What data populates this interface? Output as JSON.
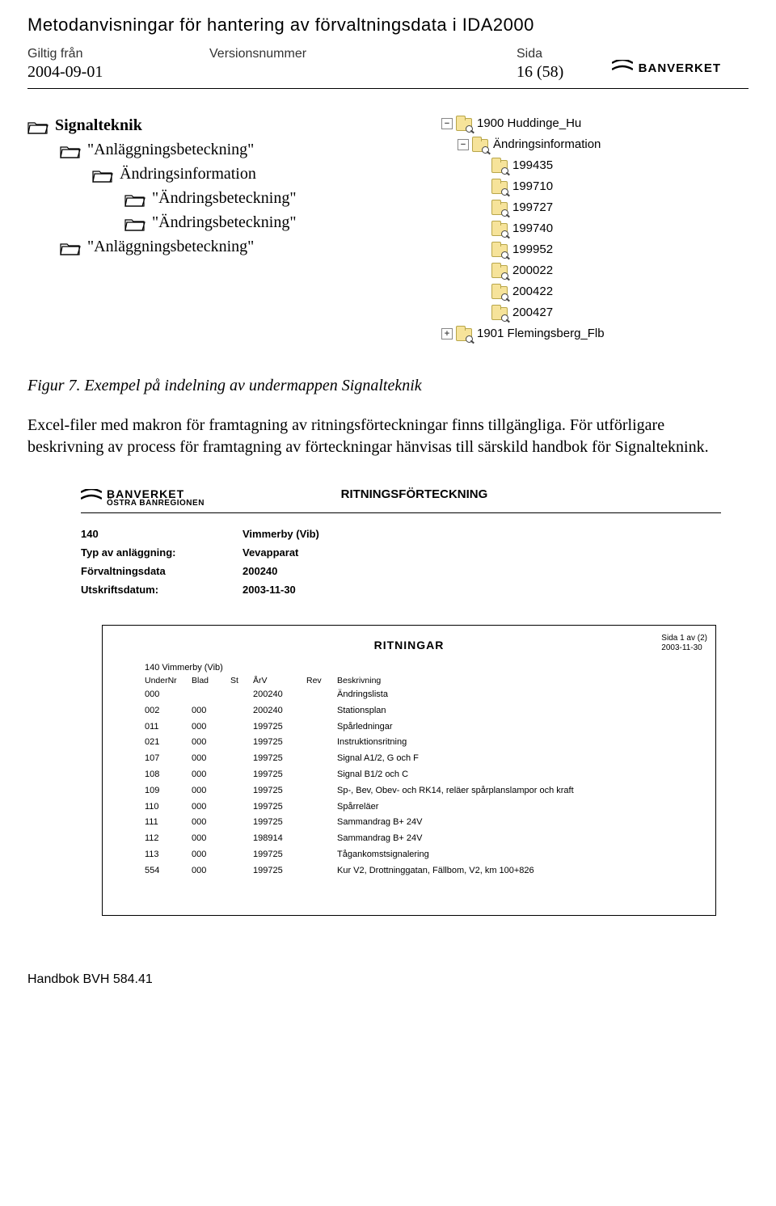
{
  "doc": {
    "title": "Metodanvisningar för hantering av förvaltningsdata i IDA2000",
    "meta_labels": {
      "from": "Giltig från",
      "ver": "Versionsnummer",
      "page": "Sida"
    },
    "meta_values": {
      "from": "2004-09-01",
      "ver": "",
      "page": "16 (58)"
    },
    "logo_text": "BANVERKET",
    "footer": "Handbok BVH 584.41"
  },
  "outline": [
    {
      "indent": 0,
      "bold": true,
      "label": "Signalteknik"
    },
    {
      "indent": 1,
      "bold": false,
      "label": "\"Anläggningsbeteckning\""
    },
    {
      "indent": 2,
      "bold": false,
      "label": "Ändringsinformation"
    },
    {
      "indent": 3,
      "bold": false,
      "label": "\"Ändringsbeteckning\""
    },
    {
      "indent": 3,
      "bold": false,
      "label": "\"Ändringsbeteckning\""
    },
    {
      "indent": 1,
      "bold": false,
      "label": "\"Anläggningsbeteckning\""
    }
  ],
  "tree": {
    "items": [
      {
        "indent": 1,
        "exp": "-",
        "label": "1900 Huddinge_Hu"
      },
      {
        "indent": 2,
        "exp": "-",
        "label": "Ändringsinformation"
      },
      {
        "indent": 3,
        "exp": "",
        "label": "199435"
      },
      {
        "indent": 3,
        "exp": "",
        "label": "199710"
      },
      {
        "indent": 3,
        "exp": "",
        "label": "199727"
      },
      {
        "indent": 3,
        "exp": "",
        "label": "199740"
      },
      {
        "indent": 3,
        "exp": "",
        "label": "199952"
      },
      {
        "indent": 3,
        "exp": "",
        "label": "200022"
      },
      {
        "indent": 3,
        "exp": "",
        "label": "200422"
      },
      {
        "indent": 3,
        "exp": "",
        "label": "200427"
      },
      {
        "indent": 1,
        "exp": "+",
        "label": "1901 Flemingsberg_Flb"
      }
    ]
  },
  "caption": "Figur 7. Exempel på indelning av undermappen Signalteknik",
  "body": {
    "p1": "Excel-filer med makron för framtagning av ritningsförteckningar finns tillgängliga. För utförligare beskrivning av process för framtagning av förteckningar hänvisas till särskild handbok för Signalteknink."
  },
  "report": {
    "logo_text": "BANVERKET",
    "logo_sub": "ÖSTRA BANREGIONEN",
    "title": "RITNINGSFÖRTECKNING",
    "meta": [
      {
        "k": "140",
        "v": "Vimmerby (Vib)"
      },
      {
        "k": "Typ av anläggning:",
        "v": "Vevapparat"
      },
      {
        "k": "Förvaltningsdata",
        "v": "200240"
      },
      {
        "k": "Utskriftsdatum:",
        "v": "2003-11-30"
      }
    ],
    "inner": {
      "title": "RITNINGAR",
      "side1": "Sida 1 av (2)",
      "side2": "2003-11-30",
      "subhead": "140 Vimmerby (Vib)",
      "cols": {
        "u": "UnderNr",
        "b": "Blad",
        "s": "St",
        "a": "ÅrV",
        "r": "Rev",
        "d": "Beskrivning"
      },
      "rows": [
        {
          "u": "000",
          "b": "",
          "s": "",
          "a": "200240",
          "r": "",
          "d": "Ändringslista"
        },
        {
          "u": "002",
          "b": "000",
          "s": "",
          "a": "200240",
          "r": "",
          "d": "Stationsplan"
        },
        {
          "u": "011",
          "b": "000",
          "s": "",
          "a": "199725",
          "r": "",
          "d": "Spårledningar"
        },
        {
          "u": "021",
          "b": "000",
          "s": "",
          "a": "199725",
          "r": "",
          "d": "Instruktionsritning"
        },
        {
          "u": "107",
          "b": "000",
          "s": "",
          "a": "199725",
          "r": "",
          "d": "Signal A1/2, G och F"
        },
        {
          "u": "108",
          "b": "000",
          "s": "",
          "a": "199725",
          "r": "",
          "d": "Signal B1/2 och C"
        },
        {
          "u": "109",
          "b": "000",
          "s": "",
          "a": "199725",
          "r": "",
          "d": "Sp-, Bev, Obev- och RK14, reläer spårplanslampor och kraft"
        },
        {
          "u": "110",
          "b": "000",
          "s": "",
          "a": "199725",
          "r": "",
          "d": "Spårreläer"
        },
        {
          "u": "111",
          "b": "000",
          "s": "",
          "a": "199725",
          "r": "",
          "d": "Sammandrag B+ 24V"
        },
        {
          "u": "112",
          "b": "000",
          "s": "",
          "a": "198914",
          "r": "",
          "d": "Sammandrag B+ 24V"
        },
        {
          "u": "113",
          "b": "000",
          "s": "",
          "a": "199725",
          "r": "",
          "d": "Tågankomstsignalering"
        },
        {
          "u": "554",
          "b": "000",
          "s": "",
          "a": "199725",
          "r": "",
          "d": "Kur V2, Drottninggatan, Fällbom, V2, km 100+826"
        }
      ]
    }
  }
}
